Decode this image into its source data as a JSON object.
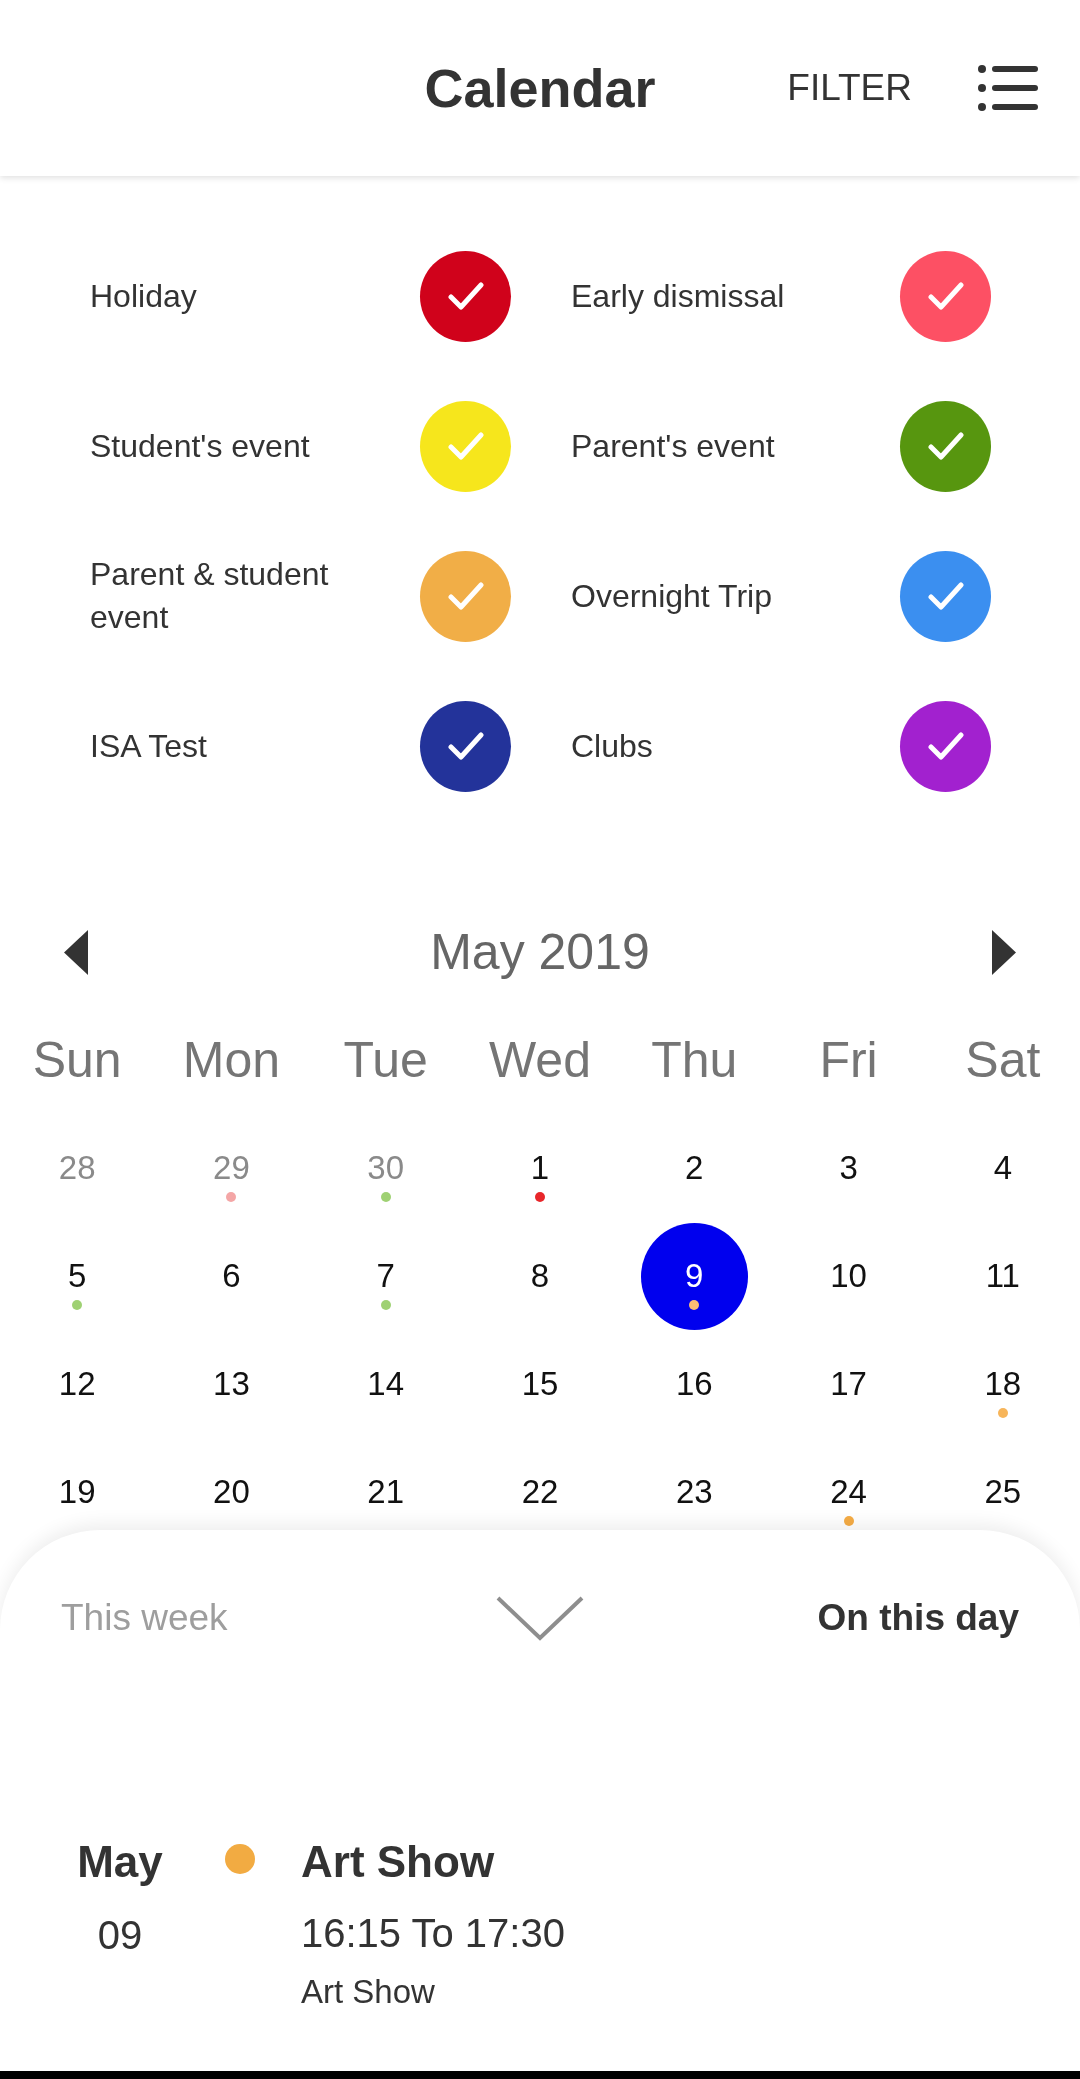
{
  "app_bar": {
    "title": "Calendar",
    "filter_button": "FILTER"
  },
  "legend": [
    {
      "label": "Holiday",
      "color": "#d0021b",
      "checked": true
    },
    {
      "label": "Early dismissal",
      "color": "#fd5064",
      "checked": true
    },
    {
      "label": "Student's event",
      "color": "#f6e61c",
      "checked": true
    },
    {
      "label": "Parent's event",
      "color": "#57960f",
      "checked": true
    },
    {
      "label": "Parent & student event",
      "color": "#f1ae47",
      "checked": true
    },
    {
      "label": "Overnight Trip",
      "color": "#3b8ff0",
      "checked": true
    },
    {
      "label": "ISA Test",
      "color": "#23339a",
      "checked": true
    },
    {
      "label": "Clubs",
      "color": "#a221cf",
      "checked": true
    }
  ],
  "calendar": {
    "month": "May 2019",
    "weekdays": [
      "Sun",
      "Mon",
      "Tue",
      "Wed",
      "Thu",
      "Fri",
      "Sat"
    ],
    "weeks": [
      [
        {
          "day": "28",
          "outside_month": true,
          "selected": false
        },
        {
          "day": "29",
          "outside_month": true,
          "selected": false,
          "color": "#f4a6a6"
        },
        {
          "day": "30",
          "outside_month": true,
          "selected": false,
          "color": "#9fd173"
        },
        {
          "day": "1",
          "outside_month": false,
          "selected": false,
          "color": "#e8262a"
        },
        {
          "day": "2",
          "outside_month": false,
          "selected": false
        },
        {
          "day": "3",
          "outside_month": false,
          "selected": false
        },
        {
          "day": "4",
          "outside_month": false,
          "selected": false
        }
      ],
      [
        {
          "day": "5",
          "outside_month": false,
          "selected": false,
          "color": "#9fd173"
        },
        {
          "day": "6",
          "outside_month": false,
          "selected": false
        },
        {
          "day": "7",
          "outside_month": false,
          "selected": false,
          "color": "#9fd173"
        },
        {
          "day": "8",
          "outside_month": false,
          "selected": false
        },
        {
          "day": "9",
          "outside_month": false,
          "selected": true,
          "color": "#fbbd75"
        },
        {
          "day": "10",
          "outside_month": false,
          "selected": false
        },
        {
          "day": "11",
          "outside_month": false,
          "selected": false
        }
      ],
      [
        {
          "day": "12",
          "outside_month": false,
          "selected": false
        },
        {
          "day": "13",
          "outside_month": false,
          "selected": false
        },
        {
          "day": "14",
          "outside_month": false,
          "selected": false
        },
        {
          "day": "15",
          "outside_month": false,
          "selected": false
        },
        {
          "day": "16",
          "outside_month": false,
          "selected": false
        },
        {
          "day": "17",
          "outside_month": false,
          "selected": false
        },
        {
          "day": "18",
          "outside_month": false,
          "selected": false,
          "color": "#f7b55a"
        }
      ],
      [
        {
          "day": "19",
          "outside_month": false,
          "selected": false
        },
        {
          "day": "20",
          "outside_month": false,
          "selected": false
        },
        {
          "day": "21",
          "outside_month": false,
          "selected": false
        },
        {
          "day": "22",
          "outside_month": false,
          "selected": false
        },
        {
          "day": "23",
          "outside_month": false,
          "selected": false
        },
        {
          "day": "24",
          "outside_month": false,
          "selected": false,
          "color": "#f5ac45"
        },
        {
          "day": "25",
          "outside_month": false,
          "selected": false
        }
      ]
    ]
  },
  "bottom_sheet": {
    "tabs": [
      {
        "label": "This week",
        "selected": false
      },
      {
        "label": "On this day",
        "selected": true
      }
    ],
    "events": [
      {
        "month": "May",
        "day": "09",
        "color": "#f2ab42",
        "title": "Art Show",
        "time": "16:15 To 17:30",
        "description": "Art Show"
      }
    ]
  }
}
